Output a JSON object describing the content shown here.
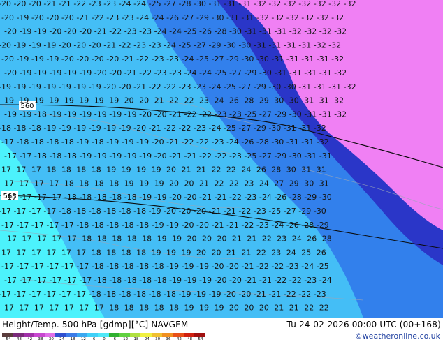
{
  "footer": {
    "caption": "Height/Temp. 500 hPa [gdmp][°C] NAVGEM",
    "valid_time": "Tu 24-02-2026 00:00 UTC (00+168)",
    "credit": "©weatheronline.co.uk",
    "colorbar_ticks": [
      "-54",
      "-48",
      "-42",
      "-38",
      "-30",
      "-24",
      "-18",
      "-12",
      "-6",
      "0",
      "6",
      "12",
      "18",
      "24",
      "30",
      "36",
      "42",
      "48",
      "54"
    ],
    "colorbar_colors": [
      "#5a3c3c",
      "#7a2a7a",
      "#a030a8",
      "#c848d0",
      "#e070e8",
      "#3050d0",
      "#3c7ce8",
      "#3ca8f0",
      "#40d0f8",
      "#50e8f8",
      "#30b030",
      "#60d040",
      "#b0e040",
      "#f0f040",
      "#f0c030",
      "#f09020",
      "#e85018",
      "#d02010",
      "#a01010"
    ]
  },
  "contours": {
    "height_labels": [
      "560",
      "568"
    ]
  },
  "colors": {
    "band_minus16": "#4cf2fc",
    "band_minus20": "#44bef6",
    "band_minus24": "#3280ec",
    "band_minus28": "#2a36c8",
    "band_minus30": "#f080f4",
    "isohypse_line": "#0a0a0a"
  },
  "temperature_labels": [
    {
      "row": 1,
      "text": "-20 -20 -20 -21 -21 -22 -23 -23 -24 -24 -25 -27 -28 -30 -31 -31 -31 -32 -32 -32 -32 -32 -32 -32"
    },
    {
      "row": 2,
      "text": "-20 -19 -20 -20 -20 -21 -22 -23 -23 -24 -24 -26 -27 -29 -30 -31 -31 -32 -32 -32 -32 -32 -32"
    },
    {
      "row": 3,
      "text": "-20 -19 -19 -20 -20 -20 -21 -22 -23 -23 -24 -24 -25 -26 -28 -30 -31 -31 -31 -32 -32 -32 -32"
    },
    {
      "row": 4,
      "text": "-20 -19 -19 -19 -20 -20 -20 -21 -22 -23 -23 -24 -25 -27 -29 -30 -30 -31 -31 -31 -31 -32 -32"
    },
    {
      "row": 5,
      "text": "-20 -19 -19 -19 -20 -20 -20 -20 -21 -22 -23 -23 -24 -25 -27 -29 -30 -30 -31 -31 -31 -31 -32"
    },
    {
      "row": 6,
      "text": "-20 -19 -19 -19 -19 -19 -20 -20 -21 -22 -23 -23 -24 -24 -25 -27 -29 -30 -31 -31 -31 -31 -32"
    },
    {
      "row": 7,
      "text": "-19 -19 -19 -19 -19 -19 -19 -20 -20 -21 -22 -22 -23 -23 -24 -25 -27 -29 -30 -30 -31 -31 -31 -32"
    },
    {
      "row": 8,
      "text": "-19 -19 -19 -19 -19 -19 -19 -19 -20 -20 -21 -22 -22 -23 -24 -26 -28 -29 -30 -30 -31 -31 -32"
    },
    {
      "row": 9,
      "text": "-19 -19 -18 -19 -19 -19 -19 -19 -19 -20 -20 -21 -22 -22 -23 -23 -25 -27 -29 -30 -31 -31 -32"
    },
    {
      "row": 10,
      "text": "-18 -18 -18 -19 -19 -19 -19 -19 -19 -20 -21 -22 -22 -23 -24 -25 -27 -29 -30 -31 -31 -32"
    },
    {
      "row": 11,
      "text": "-17 -18 -18 -18 -18 -19 -18 -19 -19 -19 -20 -21 -22 -22 -23 -24 -26 -28 -30 -31 -31 -32"
    },
    {
      "row": 12,
      "text": "-17 -17 -18 -18 -18 -19 -19 -19 -19 -19 -20 -21 -21 -22 -22 -23 -25 -27 -29 -30 -31 -31"
    },
    {
      "row": 13,
      "text": "-17 -17 -17 -18 -18 -18 -18 -19 -19 -19 -19 -20 -21 -21 -22 -22 -24 -26 -28 -30 -31 -31"
    },
    {
      "row": 14,
      "text": "-17 -17 -17 -17 -18 -18 -18 -18 -19 -19 -19 -20 -20 -21 -22 -22 -23 -24 -27 -29 -30 -31"
    },
    {
      "row": 15,
      "text": "-17 -17 -17 -17 -18 -18 -18 -18 -18 -19 -19 -20 -20 -21 -21 -22 -23 -24 -26 -28 -29 -30"
    },
    {
      "row": 16,
      "text": "-17 -17 -17 -17 -18 -18 -18 -18 -18 -18 -19 -20 -20 -20 -21 -21 -22 -23 -25 -27 -29 -30"
    },
    {
      "row": 17,
      "text": "-17 -17 -17 -17 -17 -18 -18 -18 -18 -18 -19 -19 -20 -20 -21 -21 -22 -23 -24 -26 -28 -29"
    },
    {
      "row": 18,
      "text": "-17 -17 -17 -17 -17 -18 -18 -18 -18 -18 -19 -19 -20 -20 -20 -21 -21 -22 -23 -24 -26 -28"
    },
    {
      "row": 19,
      "text": "-17 -17 -17 -17 -17 -17 -18 -18 -18 -18 -19 -19 -19 -20 -20 -21 -21 -22 -23 -24 -25 -26"
    },
    {
      "row": 20,
      "text": "-17 -17 -17 -17 -17 -17 -18 -18 -18 -18 -18 -19 -19 -19 -20 -20 -21 -22 -22 -23 -24 -25"
    },
    {
      "row": 21,
      "text": "-17 -17 -17 -17 -17 -17 -18 -18 -18 -18 -18 -19 -19 -19 -20 -20 -21 -21 -22 -22 -23 -24"
    },
    {
      "row": 22,
      "text": "-17 -17 -17 -17 -17 -17 -18 -18 -18 -18 -18 -18 -19 -19 -19 -20 -20 -21 -21 -22 -22 -23"
    },
    {
      "row": 23,
      "text": "-17 -17 -17 -17 -17 -17 -17 -18 -18 -18 -18 -18 -19 -19 -19 -20 -20 -20 -21 -21 -22 -22"
    }
  ]
}
